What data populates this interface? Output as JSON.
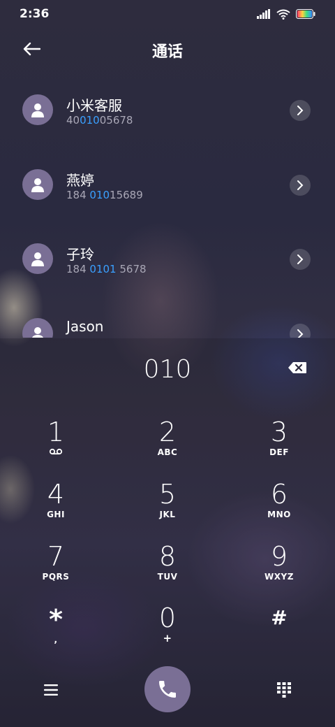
{
  "status": {
    "time": "2:36",
    "icons": [
      "signal-icon",
      "wifi-icon",
      "battery-icon"
    ]
  },
  "header": {
    "title": "通话",
    "back_icon": "back-arrow-icon"
  },
  "contacts": [
    {
      "name": "小米客服",
      "number_pre": "40",
      "number_hl": "010",
      "number_post": "05678"
    },
    {
      "name": "燕婷",
      "number_pre": "184 ",
      "number_hl": "010",
      "number_post": "15689"
    },
    {
      "name": "子玲",
      "number_pre": "184 ",
      "number_hl": "0101",
      "number_post": " 5678"
    },
    {
      "name": "Jason",
      "number_pre": "",
      "number_hl": "",
      "number_post": ""
    }
  ],
  "dialer": {
    "input": "010",
    "keys": [
      {
        "digit": "1",
        "sub": ""
      },
      {
        "digit": "2",
        "sub": "ABC"
      },
      {
        "digit": "3",
        "sub": "DEF"
      },
      {
        "digit": "4",
        "sub": "GHI"
      },
      {
        "digit": "5",
        "sub": "JKL"
      },
      {
        "digit": "6",
        "sub": "MNO"
      },
      {
        "digit": "7",
        "sub": "PQRS"
      },
      {
        "digit": "8",
        "sub": "TUV"
      },
      {
        "digit": "9",
        "sub": "WXYZ"
      },
      {
        "digit": "*",
        "sub": ","
      },
      {
        "digit": "0",
        "sub": "+"
      },
      {
        "digit": "#",
        "sub": ""
      }
    ]
  },
  "colors": {
    "accent": "#7a6f95",
    "highlight": "#3aa0ff"
  }
}
